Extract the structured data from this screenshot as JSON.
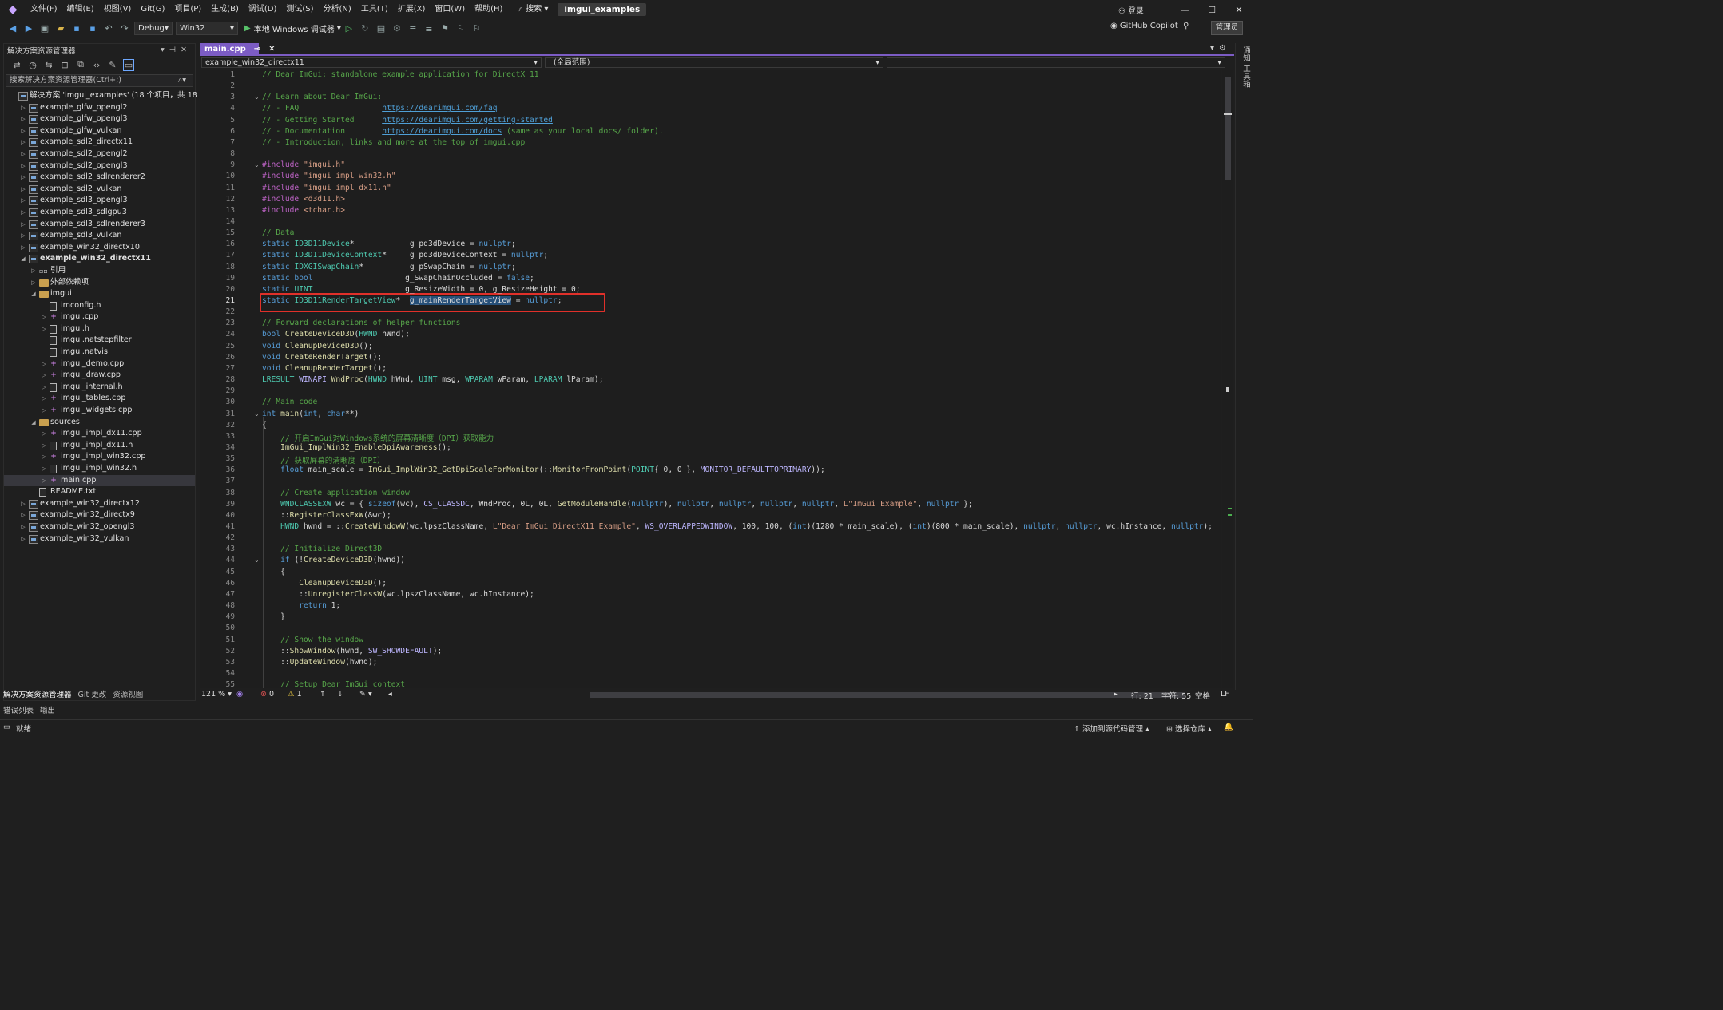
{
  "titlebar": {
    "menus": [
      "文件(F)",
      "编辑(E)",
      "视图(V)",
      "Git(G)",
      "项目(P)",
      "生成(B)",
      "调试(D)",
      "测试(S)",
      "分析(N)",
      "工具(T)",
      "扩展(X)",
      "窗口(W)",
      "帮助(H)"
    ],
    "search_label": "搜索",
    "solution_title": "imgui_examples",
    "login": "登录"
  },
  "toolbar": {
    "config": "Debug",
    "platform": "Win32",
    "run_label": "本地 Windows 调试器",
    "copilot": "GitHub Copilot",
    "admin": "管理员"
  },
  "solution_explorer": {
    "title": "解决方案资源管理器",
    "search_placeholder": "搜索解决方案资源管理器(Ctrl+;)",
    "tree": [
      {
        "label": "解决方案 'imgui_examples' (18 个项目，共 18 个)",
        "indent": 0,
        "icon": "solution",
        "arrow": ""
      },
      {
        "label": "example_glfw_opengl2",
        "indent": 1,
        "icon": "proj",
        "arrow": "▷"
      },
      {
        "label": "example_glfw_opengl3",
        "indent": 1,
        "icon": "proj",
        "arrow": "▷"
      },
      {
        "label": "example_glfw_vulkan",
        "indent": 1,
        "icon": "proj",
        "arrow": "▷"
      },
      {
        "label": "example_sdl2_directx11",
        "indent": 1,
        "icon": "proj",
        "arrow": "▷"
      },
      {
        "label": "example_sdl2_opengl2",
        "indent": 1,
        "icon": "proj",
        "arrow": "▷"
      },
      {
        "label": "example_sdl2_opengl3",
        "indent": 1,
        "icon": "proj",
        "arrow": "▷"
      },
      {
        "label": "example_sdl2_sdlrenderer2",
        "indent": 1,
        "icon": "proj",
        "arrow": "▷"
      },
      {
        "label": "example_sdl2_vulkan",
        "indent": 1,
        "icon": "proj",
        "arrow": "▷"
      },
      {
        "label": "example_sdl3_opengl3",
        "indent": 1,
        "icon": "proj",
        "arrow": "▷"
      },
      {
        "label": "example_sdl3_sdlgpu3",
        "indent": 1,
        "icon": "proj",
        "arrow": "▷"
      },
      {
        "label": "example_sdl3_sdlrenderer3",
        "indent": 1,
        "icon": "proj",
        "arrow": "▷"
      },
      {
        "label": "example_sdl3_vulkan",
        "indent": 1,
        "icon": "proj",
        "arrow": "▷"
      },
      {
        "label": "example_win32_directx10",
        "indent": 1,
        "icon": "proj",
        "arrow": "▷"
      },
      {
        "label": "example_win32_directx11",
        "indent": 1,
        "icon": "proj",
        "arrow": "◢",
        "bold": true
      },
      {
        "label": "引用",
        "indent": 2,
        "icon": "ref",
        "arrow": "▷"
      },
      {
        "label": "外部依赖项",
        "indent": 2,
        "icon": "folder",
        "arrow": "▷"
      },
      {
        "label": "imgui",
        "indent": 2,
        "icon": "folder",
        "arrow": "◢"
      },
      {
        "label": "imconfig.h",
        "indent": 3,
        "icon": "file",
        "arrow": ""
      },
      {
        "label": "imgui.cpp",
        "indent": 3,
        "icon": "cpp",
        "arrow": "▷"
      },
      {
        "label": "imgui.h",
        "indent": 3,
        "icon": "file",
        "arrow": "▷"
      },
      {
        "label": "imgui.natstepfilter",
        "indent": 3,
        "icon": "file",
        "arrow": ""
      },
      {
        "label": "imgui.natvis",
        "indent": 3,
        "icon": "file",
        "arrow": ""
      },
      {
        "label": "imgui_demo.cpp",
        "indent": 3,
        "icon": "cpp",
        "arrow": "▷"
      },
      {
        "label": "imgui_draw.cpp",
        "indent": 3,
        "icon": "cpp",
        "arrow": "▷"
      },
      {
        "label": "imgui_internal.h",
        "indent": 3,
        "icon": "file",
        "arrow": "▷"
      },
      {
        "label": "imgui_tables.cpp",
        "indent": 3,
        "icon": "cpp",
        "arrow": "▷"
      },
      {
        "label": "imgui_widgets.cpp",
        "indent": 3,
        "icon": "cpp",
        "arrow": "▷"
      },
      {
        "label": "sources",
        "indent": 2,
        "icon": "folder",
        "arrow": "◢"
      },
      {
        "label": "imgui_impl_dx11.cpp",
        "indent": 3,
        "icon": "cpp",
        "arrow": "▷"
      },
      {
        "label": "imgui_impl_dx11.h",
        "indent": 3,
        "icon": "file",
        "arrow": "▷"
      },
      {
        "label": "imgui_impl_win32.cpp",
        "indent": 3,
        "icon": "cpp",
        "arrow": "▷"
      },
      {
        "label": "imgui_impl_win32.h",
        "indent": 3,
        "icon": "file",
        "arrow": "▷"
      },
      {
        "label": "main.cpp",
        "indent": 3,
        "icon": "cpp",
        "arrow": "▷",
        "selected": true
      },
      {
        "label": "README.txt",
        "indent": 2,
        "icon": "file",
        "arrow": ""
      },
      {
        "label": "example_win32_directx12",
        "indent": 1,
        "icon": "proj",
        "arrow": "▷"
      },
      {
        "label": "example_win32_directx9",
        "indent": 1,
        "icon": "proj",
        "arrow": "▷"
      },
      {
        "label": "example_win32_opengl3",
        "indent": 1,
        "icon": "proj",
        "arrow": "▷"
      },
      {
        "label": "example_win32_vulkan",
        "indent": 1,
        "icon": "proj",
        "arrow": "▷"
      }
    ],
    "tabs": [
      "解决方案资源管理器",
      "Git 更改",
      "资源视图"
    ]
  },
  "editor": {
    "tab": "main.cpp",
    "nav_project": "example_win32_directx11",
    "nav_scope": "(全局范围)",
    "line_numbers": [
      "1",
      "2",
      "3",
      "4",
      "5",
      "6",
      "7",
      "8",
      "9",
      "10",
      "11",
      "12",
      "13",
      "14",
      "15",
      "16",
      "17",
      "18",
      "19",
      "20",
      "21",
      "22",
      "23",
      "24",
      "25",
      "26",
      "27",
      "28",
      "29",
      "30",
      "31",
      "32",
      "33",
      "34",
      "35",
      "36",
      "37",
      "38",
      "39",
      "40",
      "41",
      "42",
      "43",
      "44",
      "45",
      "46",
      "47",
      "48",
      "49",
      "50",
      "51",
      "52",
      "53",
      "54",
      "55"
    ],
    "lines": [
      [
        [
          "c",
          "// Dear ImGui: standalone example application for DirectX 11"
        ]
      ],
      [],
      [
        [
          "c",
          "// Learn about Dear ImGui:"
        ]
      ],
      [
        [
          "c",
          "// - FAQ                  "
        ],
        [
          "u",
          "https://dearimgui.com/faq"
        ]
      ],
      [
        [
          "c",
          "// - Getting Started      "
        ],
        [
          "u",
          "https://dearimgui.com/getting-started"
        ]
      ],
      [
        [
          "c",
          "// - Documentation        "
        ],
        [
          "u",
          "https://dearimgui.com/docs"
        ],
        [
          "c",
          " (same as your local docs/ folder)."
        ]
      ],
      [
        [
          "c",
          "// - Introduction, links and more at the top of imgui.cpp"
        ]
      ],
      [],
      [
        [
          "g",
          "#include "
        ],
        [
          "s",
          "\"imgui.h\""
        ]
      ],
      [
        [
          "g",
          "#include "
        ],
        [
          "s",
          "\"imgui_impl_win32.h\""
        ]
      ],
      [
        [
          "g",
          "#include "
        ],
        [
          "s",
          "\"imgui_impl_dx11.h\""
        ]
      ],
      [
        [
          "g",
          "#include "
        ],
        [
          "s",
          "<d3d11.h>"
        ]
      ],
      [
        [
          "g",
          "#include "
        ],
        [
          "s",
          "<tchar.h>"
        ]
      ],
      [],
      [
        [
          "c",
          "// Data"
        ]
      ],
      [
        [
          "k",
          "static "
        ],
        [
          "t",
          "ID3D11Device"
        ],
        [
          "v",
          "*            g_pd3dDevice = "
        ],
        [
          "k",
          "nullptr"
        ],
        [
          "v",
          ";"
        ]
      ],
      [
        [
          "k",
          "static "
        ],
        [
          "t",
          "ID3D11DeviceContext"
        ],
        [
          "v",
          "*     g_pd3dDeviceContext = "
        ],
        [
          "k",
          "nullptr"
        ],
        [
          "v",
          ";"
        ]
      ],
      [
        [
          "k",
          "static "
        ],
        [
          "t",
          "IDXGISwapChain"
        ],
        [
          "v",
          "*          g_pSwapChain = "
        ],
        [
          "k",
          "nullptr"
        ],
        [
          "v",
          ";"
        ]
      ],
      [
        [
          "k",
          "static bool"
        ],
        [
          "v",
          "                    g_SwapChainOccluded = "
        ],
        [
          "k",
          "false"
        ],
        [
          "v",
          ";"
        ]
      ],
      [
        [
          "k",
          "static "
        ],
        [
          "t",
          "UINT"
        ],
        [
          "v",
          "                    g_ResizeWidth = 0, g_ResizeHeight = 0;"
        ]
      ],
      [
        [
          "k",
          "static "
        ],
        [
          "t",
          "ID3D11RenderTargetView"
        ],
        [
          "v",
          "*  "
        ],
        [
          "hl",
          "g_mainRenderTargetView"
        ],
        [
          "v",
          " = "
        ],
        [
          "k",
          "nullptr"
        ],
        [
          "v",
          ";"
        ]
      ],
      [],
      [
        [
          "c",
          "// Forward declarations of helper functions"
        ]
      ],
      [
        [
          "k",
          "bool "
        ],
        [
          "f",
          "CreateDeviceD3D"
        ],
        [
          "v",
          "("
        ],
        [
          "t",
          "HWND"
        ],
        [
          "v",
          " hWnd);"
        ]
      ],
      [
        [
          "k",
          "void "
        ],
        [
          "f",
          "CleanupDeviceD3D"
        ],
        [
          "v",
          "();"
        ]
      ],
      [
        [
          "k",
          "void "
        ],
        [
          "f",
          "CreateRenderTarget"
        ],
        [
          "v",
          "();"
        ]
      ],
      [
        [
          "k",
          "void "
        ],
        [
          "f",
          "CleanupRenderTarget"
        ],
        [
          "v",
          "();"
        ]
      ],
      [
        [
          "t",
          "LRESULT "
        ],
        [
          "m",
          "WINAPI "
        ],
        [
          "f",
          "WndProc"
        ],
        [
          "v",
          "("
        ],
        [
          "t",
          "HWND"
        ],
        [
          "v",
          " hWnd, "
        ],
        [
          "t",
          "UINT"
        ],
        [
          "v",
          " msg, "
        ],
        [
          "t",
          "WPARAM"
        ],
        [
          "v",
          " wParam, "
        ],
        [
          "t",
          "LPARAM"
        ],
        [
          "v",
          " lParam);"
        ]
      ],
      [],
      [
        [
          "c",
          "// Main code"
        ]
      ],
      [
        [
          "k",
          "int "
        ],
        [
          "f",
          "main"
        ],
        [
          "v",
          "("
        ],
        [
          "k",
          "int"
        ],
        [
          "v",
          ", "
        ],
        [
          "k",
          "char"
        ],
        [
          "v",
          "**)"
        ]
      ],
      [
        [
          "v",
          "{"
        ]
      ],
      [
        [
          "v",
          "    "
        ],
        [
          "c",
          "// 开启ImGui对Windows系统的屏幕清晰度（DPI）获取能力"
        ]
      ],
      [
        [
          "v",
          "    "
        ],
        [
          "f",
          "ImGui_ImplWin32_EnableDpiAwareness"
        ],
        [
          "v",
          "();"
        ]
      ],
      [
        [
          "v",
          "    "
        ],
        [
          "c",
          "// 获取屏幕的清晰度（DPI）"
        ]
      ],
      [
        [
          "v",
          "    "
        ],
        [
          "k",
          "float "
        ],
        [
          "v",
          "main_scale = "
        ],
        [
          "f",
          "ImGui_ImplWin32_GetDpiScaleForMonitor"
        ],
        [
          "v",
          "(::"
        ],
        [
          "f",
          "MonitorFromPoint"
        ],
        [
          "v",
          "("
        ],
        [
          "t",
          "POINT"
        ],
        [
          "v",
          "{ 0, 0 }, "
        ],
        [
          "m",
          "MONITOR_DEFAULTTOPRIMARY"
        ],
        [
          "v",
          "));"
        ]
      ],
      [],
      [
        [
          "v",
          "    "
        ],
        [
          "c",
          "// Create application window"
        ]
      ],
      [
        [
          "v",
          "    "
        ],
        [
          "t",
          "WNDCLASSEXW"
        ],
        [
          "v",
          " wc = { "
        ],
        [
          "k",
          "sizeof"
        ],
        [
          "v",
          "(wc), "
        ],
        [
          "m",
          "CS_CLASSDC"
        ],
        [
          "v",
          ", WndProc, 0L, 0L, "
        ],
        [
          "f",
          "GetModuleHandle"
        ],
        [
          "v",
          "("
        ],
        [
          "k",
          "nullptr"
        ],
        [
          "v",
          "), "
        ],
        [
          "k",
          "nullptr"
        ],
        [
          "v",
          ", "
        ],
        [
          "k",
          "nullptr"
        ],
        [
          "v",
          ", "
        ],
        [
          "k",
          "nullptr"
        ],
        [
          "v",
          ", "
        ],
        [
          "k",
          "nullptr"
        ],
        [
          "v",
          ", "
        ],
        [
          "s",
          "L\"ImGui Example\""
        ],
        [
          "v",
          ", "
        ],
        [
          "k",
          "nullptr"
        ],
        [
          "v",
          " };"
        ]
      ],
      [
        [
          "v",
          "    ::"
        ],
        [
          "f",
          "RegisterClassExW"
        ],
        [
          "v",
          "(&wc);"
        ]
      ],
      [
        [
          "v",
          "    "
        ],
        [
          "t",
          "HWND"
        ],
        [
          "v",
          " hwnd = ::"
        ],
        [
          "f",
          "CreateWindowW"
        ],
        [
          "v",
          "(wc.lpszClassName, "
        ],
        [
          "s",
          "L\"Dear ImGui DirectX11 Example\""
        ],
        [
          "v",
          ", "
        ],
        [
          "m",
          "WS_OVERLAPPEDWINDOW"
        ],
        [
          "v",
          ", 100, 100, ("
        ],
        [
          "k",
          "int"
        ],
        [
          "v",
          ")(1280 * main_scale), ("
        ],
        [
          "k",
          "int"
        ],
        [
          "v",
          ")(800 * main_scale), "
        ],
        [
          "k",
          "nullptr"
        ],
        [
          "v",
          ", "
        ],
        [
          "k",
          "nullptr"
        ],
        [
          "v",
          ", wc.hInstance, "
        ],
        [
          "k",
          "nullptr"
        ],
        [
          "v",
          ");"
        ]
      ],
      [],
      [
        [
          "v",
          "    "
        ],
        [
          "c",
          "// Initialize Direct3D"
        ]
      ],
      [
        [
          "v",
          "    "
        ],
        [
          "k",
          "if"
        ],
        [
          "v",
          " (!"
        ],
        [
          "f",
          "CreateDeviceD3D"
        ],
        [
          "v",
          "(hwnd))"
        ]
      ],
      [
        [
          "v",
          "    {"
        ]
      ],
      [
        [
          "v",
          "        "
        ],
        [
          "f",
          "CleanupDeviceD3D"
        ],
        [
          "v",
          "();"
        ]
      ],
      [
        [
          "v",
          "        ::"
        ],
        [
          "f",
          "UnregisterClassW"
        ],
        [
          "v",
          "(wc.lpszClassName, wc.hInstance);"
        ]
      ],
      [
        [
          "v",
          "        "
        ],
        [
          "k",
          "return"
        ],
        [
          "v",
          " 1;"
        ]
      ],
      [
        [
          "v",
          "    }"
        ]
      ],
      [],
      [
        [
          "v",
          "    "
        ],
        [
          "c",
          "// Show the window"
        ]
      ],
      [
        [
          "v",
          "    ::"
        ],
        [
          "f",
          "ShowWindow"
        ],
        [
          "v",
          "(hwnd, "
        ],
        [
          "m",
          "SW_SHOWDEFAULT"
        ],
        [
          "v",
          ");"
        ]
      ],
      [
        [
          "v",
          "    ::"
        ],
        [
          "f",
          "UpdateWindow"
        ],
        [
          "v",
          "(hwnd);"
        ]
      ],
      [],
      [
        [
          "v",
          "    "
        ],
        [
          "c",
          "// Setup Dear ImGui context"
        ]
      ]
    ],
    "folds": [
      3,
      9,
      31,
      44
    ]
  },
  "editor_status": {
    "zoom": "121 %",
    "errors": "0",
    "warnings": "1",
    "line": "行: 21",
    "char": "字符: 55",
    "whitespace": "空格",
    "eol": "LF"
  },
  "bottom_tabs": [
    "错误列表",
    "输出"
  ],
  "statusbar": {
    "ready": "就绪",
    "add_source": "添加到源代码管理",
    "select_repo": "选择仓库"
  },
  "right_strip": [
    "通知",
    "工具箱"
  ]
}
